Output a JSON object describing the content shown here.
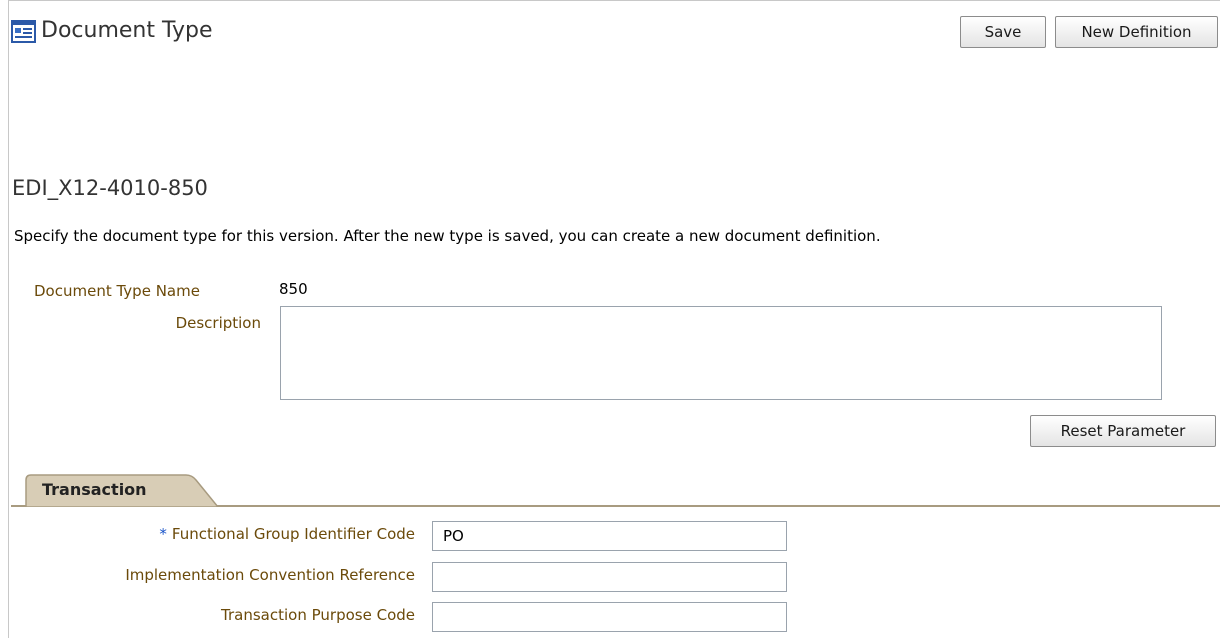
{
  "header": {
    "title": "Document Type",
    "icon": "document-type-icon"
  },
  "toolbar": {
    "save_label": "Save",
    "new_definition_label": "New Definition"
  },
  "section": {
    "title": "EDI_X12-4010-850",
    "instructions": "Specify the document type for this version. After the new type is saved, you can create a new document definition."
  },
  "form": {
    "document_type_name_label": "Document Type Name",
    "document_type_name_value": "850",
    "description_label": "Description",
    "description_value": "",
    "reset_parameter_label": "Reset Parameter"
  },
  "tabs": [
    {
      "label": "Transaction",
      "selected": true
    }
  ],
  "transaction": {
    "required_marker": "*",
    "fields": [
      {
        "label": "Functional Group Identifier Code",
        "value": "PO",
        "required": true
      },
      {
        "label": "Implementation Convention Reference",
        "value": "",
        "required": false
      },
      {
        "label": "Transaction Purpose Code",
        "value": "",
        "required": false
      }
    ]
  },
  "colors": {
    "label_text": "#6b4a0a",
    "required_star": "#1a55c9",
    "tab_background": "#d8cdb6",
    "tab_line": "#a89b80"
  }
}
